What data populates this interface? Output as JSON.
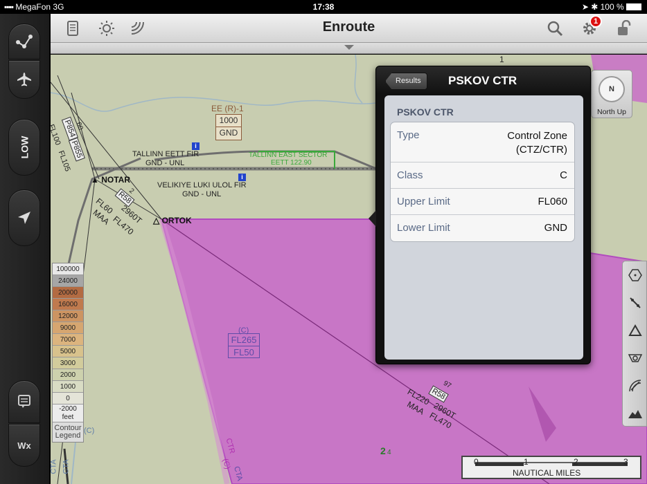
{
  "status": {
    "carrier": "MegaFon",
    "network": "3G",
    "time": "17:38",
    "battery": "100 %"
  },
  "header": {
    "title": "Enroute",
    "badge": "1"
  },
  "leftbar": {
    "low_label": "LOW",
    "wx_label": "Wx"
  },
  "map": {
    "labels": {
      "ee_r1": "EE (R)-1",
      "ee_top": "1000",
      "ee_bottom": "GND",
      "tallinn_fir": "TALLINN EETT FIR",
      "tallinn_limits": "GND - UNL",
      "tallinn_east": "TALLINN EAST SECTOR",
      "tallinn_freq": "EETT 122.90",
      "velikiye": "VELIKIYE LUKI ULOL FIR",
      "velikiye_limits": "GND - UNL",
      "notar": "NOTAR",
      "ortok": "ORTOK",
      "r58_a": "R58",
      "r58_a_num": "2",
      "fl60": "FL60",
      "fl60_dist": "2960T",
      "maa_a": "MAA",
      "maa_a_fl": "FL470",
      "p854": "P854",
      "p855": "P855",
      "fl100": "FL100",
      "fl105": "FL105",
      "num60": "60",
      "ctr_c": "(C)",
      "fl265": "FL265",
      "fl50": "FL50",
      "r58_b": "R58",
      "r58_b_num": "97",
      "fl220": "FL220",
      "fl220_dist": "2960T",
      "maa_b": "MAA",
      "maa_b_fl": "FL470",
      "ctr_vert": "CTR",
      "ctr_vert_c": "(C)",
      "cta1": "CTA",
      "cta2": "CTA",
      "cta3": "CTA",
      "c_left": "(C)",
      "num1": "1",
      "num2": "2",
      "num4": "4"
    },
    "legend": {
      "cells": [
        {
          "label": "100000",
          "color": "#e8e8e8"
        },
        {
          "label": "24000",
          "color": "#a6a6a6"
        },
        {
          "label": "20000",
          "color": "#b36b42"
        },
        {
          "label": "16000",
          "color": "#c07a4e"
        },
        {
          "label": "12000",
          "color": "#cc9462"
        },
        {
          "label": "9000",
          "color": "#d6a670"
        },
        {
          "label": "7000",
          "color": "#dcb47e"
        },
        {
          "label": "5000",
          "color": "#d8c28c"
        },
        {
          "label": "3000",
          "color": "#d2cc9c"
        },
        {
          "label": "2000",
          "color": "#cdd1ad"
        },
        {
          "label": "1000",
          "color": "#d9dcc4"
        },
        {
          "label": "0",
          "color": "#e4e4d8"
        },
        {
          "label": "-2000 feet",
          "color": "#ececec"
        }
      ],
      "caption_1": "Contour",
      "caption_2": "Legend"
    },
    "scale": {
      "ticks": [
        "0",
        "1",
        "2",
        "3"
      ],
      "caption": "NAUTICAL MILES"
    }
  },
  "popup": {
    "back_label": "Results",
    "title": "PSKOV CTR",
    "section": "PSKOV CTR",
    "rows": [
      {
        "key": "Type",
        "value_1": "Control Zone",
        "value_2": "(CTZ/CTR)"
      },
      {
        "key": "Class",
        "value": "C"
      },
      {
        "key": "Upper Limit",
        "value": "FL060"
      },
      {
        "key": "Lower Limit",
        "value": "GND"
      }
    ]
  },
  "northup": {
    "letter": "N",
    "label": "North Up"
  },
  "colors": {
    "map_bg": "#c8cdb0",
    "airspace": "#c96fc8",
    "airspace_border": "#b040c0",
    "water": "#9fb7c6"
  }
}
